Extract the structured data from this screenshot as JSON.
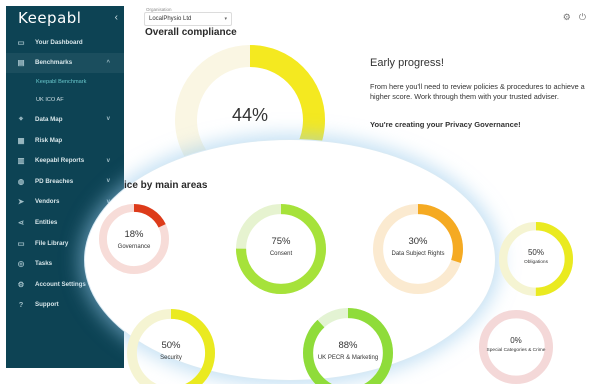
{
  "brand": {
    "logo": "Keepabl"
  },
  "sidebar": {
    "collapse": "‹",
    "items": [
      {
        "label": "Your Dashboard",
        "icon": "dashboard-icon",
        "glyph": "▭"
      },
      {
        "label": "Benchmarks",
        "icon": "benchmark-icon",
        "glyph": "▤",
        "chev": "^"
      },
      {
        "label": "Keepabl Benchmark",
        "sub": true,
        "active": true
      },
      {
        "label": "UK ICO AF",
        "sub": true
      },
      {
        "label": "Data Map",
        "icon": "location-pin-icon",
        "glyph": "⌖",
        "chev": "v"
      },
      {
        "label": "Risk Map",
        "icon": "risk-map-icon",
        "glyph": "▦"
      },
      {
        "label": "Keepabl Reports",
        "icon": "reports-icon",
        "glyph": "▥",
        "chev": "v"
      },
      {
        "label": "PD Breaches",
        "icon": "shield-icon",
        "glyph": "◍",
        "chev": "v"
      },
      {
        "label": "Vendors",
        "icon": "send-icon",
        "glyph": "➤",
        "chev": "v"
      },
      {
        "label": "Entities",
        "icon": "share-icon",
        "glyph": "⋖"
      },
      {
        "label": "File Library",
        "icon": "folder-icon",
        "glyph": "▭"
      },
      {
        "label": "Tasks",
        "icon": "check-circle-icon",
        "glyph": "◎"
      },
      {
        "label": "Account Settings",
        "icon": "gear-icon",
        "glyph": "⚙"
      },
      {
        "label": "Support",
        "icon": "help-icon",
        "glyph": "?"
      }
    ]
  },
  "topbar": {
    "org_label": "Organisation",
    "org_value": "LocalPhysio Ltd",
    "dropdown_glyph": "▾",
    "icons": [
      {
        "name": "settings-icon",
        "glyph": "⚙"
      },
      {
        "name": "power-icon",
        "glyph": "⏻"
      }
    ]
  },
  "overall": {
    "heading": "Overall compliance",
    "percent_label": "44%",
    "value": 44,
    "color": "#f4e920",
    "track": "#faf6e3"
  },
  "early": {
    "title": "Early progress!",
    "text": "From here you'll need to review policies & procedures to achieve a higher score. Work through them with your trusted adviser.",
    "cta": "You're creating your Privacy Governance!"
  },
  "areas": {
    "heading": "ice by main areas",
    "gauges": [
      {
        "pct": "18%",
        "value": 18,
        "label": "Governance",
        "color": "#dd3b1a",
        "track": "#f7dcd8"
      },
      {
        "pct": "75%",
        "value": 75,
        "label": "Consent",
        "color": "#a6e23a",
        "track": "#e6f3d0"
      },
      {
        "pct": "30%",
        "value": 30,
        "label": "Data Subject Rights",
        "color": "#f5aa22",
        "track": "#fbead0"
      },
      {
        "pct": "50%",
        "value": 50,
        "label": "Obligations",
        "color": "#eaea20",
        "track": "#f5f4d2"
      },
      {
        "pct": "50%",
        "value": 50,
        "label": "Security",
        "color": "#eaea20",
        "track": "#f5f4d2"
      },
      {
        "pct": "88%",
        "value": 88,
        "label": "UK PECR & Marketing",
        "color": "#8fdc3a",
        "track": "#e3f3d3"
      },
      {
        "pct": "0%",
        "value": 0,
        "label": "Special Categories & Crime",
        "color": "#dd3b1a",
        "track": "#f4d8d8"
      }
    ]
  }
}
